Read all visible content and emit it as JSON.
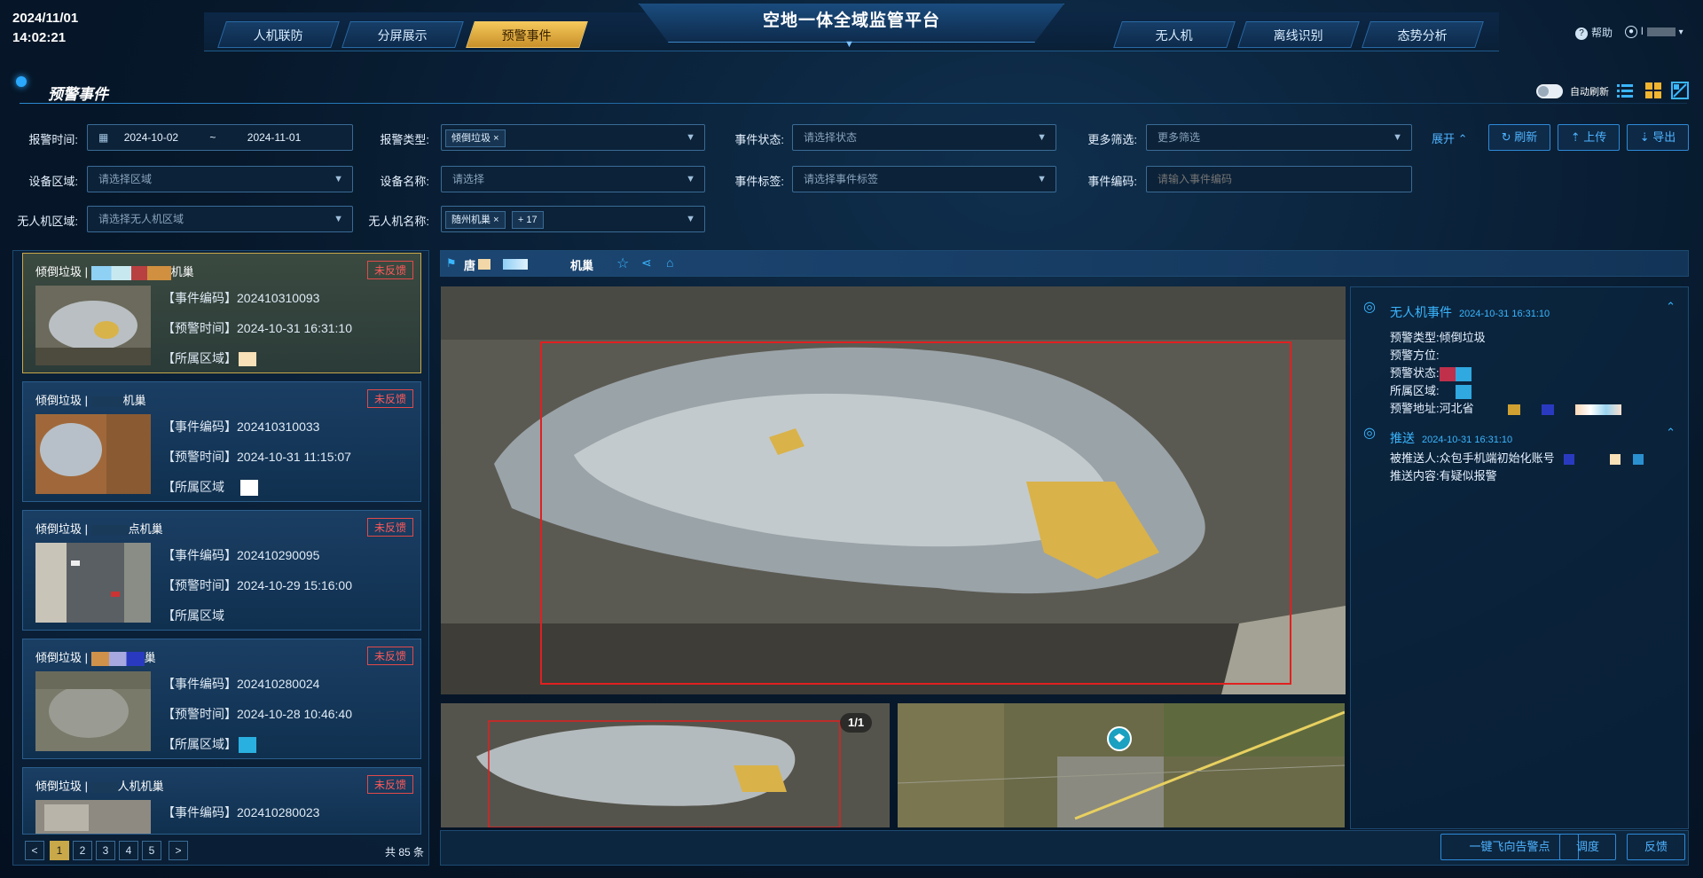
{
  "header": {
    "date": "2024/11/01",
    "time": "14:02:21",
    "title": "空地一体全域监管平台",
    "tabs_left": [
      "人机联防",
      "分屏展示",
      "预警事件"
    ],
    "tabs_right": [
      "无人机",
      "离线识别",
      "态势分析"
    ],
    "help": "帮助",
    "user": "l"
  },
  "page": {
    "title": "预警事件",
    "auto_refresh": "自动刷新"
  },
  "filters": {
    "alarm_time_label": "报警时间:",
    "date_start": "2024-10-02",
    "date_sep": "~",
    "date_end": "2024-11-01",
    "alarm_type_label": "报警类型:",
    "alarm_type_chip": "倾倒垃圾",
    "event_status_label": "事件状态:",
    "event_status_ph": "请选择状态",
    "more_label": "更多筛选:",
    "more_ph": "更多筛选",
    "device_area_label": "设备区域:",
    "device_area_ph": "请选择区域",
    "device_name_label": "设备名称:",
    "device_name_ph": "请选择",
    "event_tag_label": "事件标签:",
    "event_tag_ph": "请选择事件标签",
    "event_code_label": "事件编码:",
    "event_code_ph": "请输入事件编码",
    "uav_area_label": "无人机区域:",
    "uav_area_ph": "请选择无人机区域",
    "uav_name_label": "无人机名称:",
    "uav_name_chip": "随州机巢",
    "uav_name_more": "+ 17",
    "expand": "展开",
    "refresh": "刷新",
    "upload": "上传",
    "export": "导出"
  },
  "events": [
    {
      "type": "倾倒垃圾",
      "name": "机巢",
      "status": "未反馈",
      "code": "【事件编码】202410310093",
      "time": "【预警时间】2024-10-31 16:31:10",
      "area": "【所属区域】"
    },
    {
      "type": "倾倒垃圾",
      "name": "机巢",
      "status": "未反馈",
      "code": "【事件编码】202410310033",
      "time": "【预警时间】2024-10-31 11:15:07",
      "area": "【所属区域"
    },
    {
      "type": "倾倒垃圾",
      "name": "点机巢",
      "status": "未反馈",
      "code": "【事件编码】202410290095",
      "time": "【预警时间】2024-10-29 15:16:00",
      "area": "【所属区域"
    },
    {
      "type": "倾倒垃圾",
      "name": "巢",
      "status": "未反馈",
      "code": "【事件编码】202410280024",
      "time": "【预警时间】2024-10-28 10:46:40",
      "area": "【所属区域】"
    },
    {
      "type": "倾倒垃圾",
      "name": "人机机巢",
      "status": "未反馈",
      "code": "【事件编码】202410280023",
      "time": "",
      "area": ""
    }
  ],
  "pager": {
    "prev": "<",
    "next": ">",
    "pages": [
      "1",
      "2",
      "3",
      "4",
      "5"
    ],
    "total": "共 85 条"
  },
  "detail": {
    "location_prefix": "唐",
    "location_suffix": "机巢",
    "image_counter": "1/1",
    "uav_event_title": "无人机事件",
    "uav_event_time": "2024-10-31 16:31:10",
    "rows": [
      {
        "k": "预警类型:",
        "v": "倾倒垃圾"
      },
      {
        "k": "预警方位:",
        "v": ""
      },
      {
        "k": "预警状态:",
        "v": ""
      },
      {
        "k": "所属区域:",
        "v": ""
      },
      {
        "k": "预警地址:",
        "v": "河北省"
      }
    ],
    "push_title": "推送",
    "push_time": "2024-10-31 16:31:10",
    "push_rows": [
      {
        "k": "被推送人:",
        "v": "众包手机端初始化账号"
      },
      {
        "k": "推送内容:",
        "v": "有疑似报警"
      }
    ]
  },
  "actions": {
    "fly": "一键飞向告警点",
    "dispatch": "调度",
    "feedback": "反馈"
  },
  "colors": {
    "accent": "#2aa9ff",
    "gold": "#c9a84a",
    "alert": "#ff5a5a",
    "bbox": "#e02020"
  }
}
